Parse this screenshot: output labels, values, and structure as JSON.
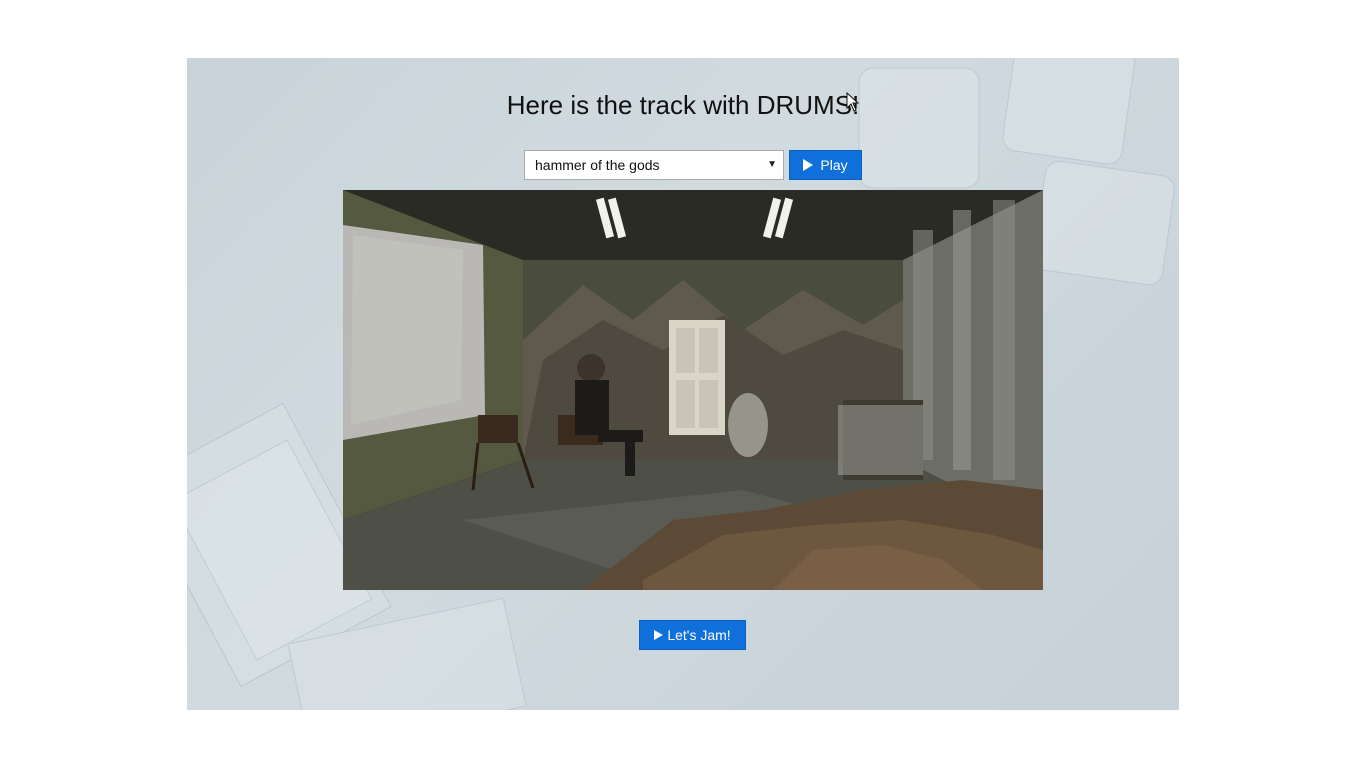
{
  "page": {
    "title": "Here is the track with DRUMS!"
  },
  "track_select": {
    "selected": "hammer of the gods"
  },
  "buttons": {
    "play_label": "Play",
    "jam_label": "Let's Jam!"
  },
  "colors": {
    "accent": "#0f6fdb",
    "panel_bg": "#cbd5db"
  },
  "icons": {
    "play": "play-triangle-icon",
    "jam": "play-triangle-icon",
    "cursor": "mouse-pointer-icon"
  }
}
